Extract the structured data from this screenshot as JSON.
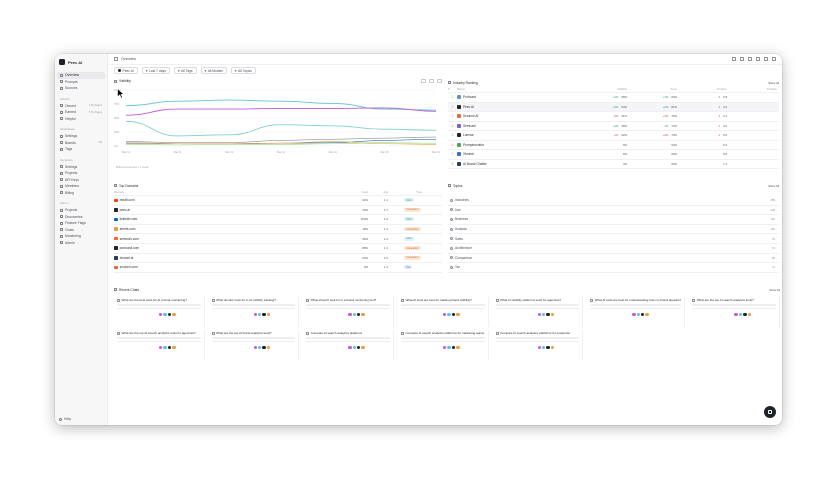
{
  "workspace": {
    "name": "Peec AI"
  },
  "sidebar": {
    "sections": [
      {
        "items": [
          {
            "label": "Overview",
            "icon": "home-icon",
            "active": true
          },
          {
            "label": "Prompts",
            "icon": "message-icon"
          },
          {
            "label": "Sources",
            "icon": "link-icon"
          }
        ]
      },
      {
        "label": "Actions",
        "items": [
          {
            "label": "Owned",
            "tag": "1.3K Pages",
            "icon": "file-icon"
          },
          {
            "label": "Earned",
            "tag": "7.7K Pages",
            "icon": "globe-icon"
          },
          {
            "label": "Helpful",
            "icon": "star-icon"
          }
        ]
      },
      {
        "label": "Workspace",
        "items": [
          {
            "label": "Settings",
            "icon": "gear-icon"
          },
          {
            "label": "Brands",
            "tag": "4/5",
            "icon": "tag-icon"
          },
          {
            "label": "Tags",
            "icon": "hash-icon"
          }
        ]
      },
      {
        "label": "Company",
        "items": [
          {
            "label": "Settings",
            "icon": "gear-icon"
          },
          {
            "label": "Projects",
            "icon": "folder-icon"
          },
          {
            "label": "API Keys",
            "icon": "key-icon"
          },
          {
            "label": "Members",
            "icon": "users-icon"
          },
          {
            "label": "Billing",
            "icon": "card-icon"
          }
        ]
      },
      {
        "label": "Admin",
        "items": [
          {
            "label": "Projects",
            "icon": "folder-icon"
          },
          {
            "label": "Discoveries",
            "icon": "search-icon"
          },
          {
            "label": "Feature Flags",
            "icon": "flag-icon"
          },
          {
            "label": "Chats",
            "icon": "chat-icon"
          },
          {
            "label": "Monitoring",
            "icon": "activity-icon"
          },
          {
            "label": "Admin",
            "icon": "shield-icon"
          }
        ]
      }
    ],
    "footer": "Help"
  },
  "topbar": {
    "title": "Overview"
  },
  "filters": [
    {
      "label": "Peec AI"
    },
    {
      "label": "Last 7 days"
    },
    {
      "label": "All Tags"
    },
    {
      "label": "All Models"
    },
    {
      "label": "All Topics"
    }
  ],
  "visibility": {
    "title": "Visibility",
    "footer": "Brand perception • 1 week"
  },
  "chart_data": {
    "type": "line",
    "x": [
      "Mar 10",
      "Mar 11",
      "Mar 12",
      "Mar 13",
      "Mar 14",
      "Mar 15",
      "Mar 16"
    ],
    "ylim": [
      0,
      100
    ],
    "yticks": [
      "100%",
      "75%",
      "50%",
      "25%",
      "0%"
    ],
    "grid": true,
    "series": [
      {
        "color": "#5fc3d6",
        "values": [
          72,
          80,
          82,
          80,
          76,
          66,
          64
        ]
      },
      {
        "color": "#c05bd6",
        "values": [
          55,
          66,
          66,
          67,
          67,
          68,
          62
        ]
      },
      {
        "color": "#7fd1c9",
        "values": [
          44,
          18,
          20,
          38,
          36,
          30,
          28
        ]
      },
      {
        "color": "#3a6fb0",
        "values": [
          5,
          4,
          4,
          5,
          6,
          10,
          12
        ]
      },
      {
        "color": "#e0a248",
        "values": [
          6,
          4,
          4,
          5,
          8,
          4,
          3
        ]
      },
      {
        "color": "#8a8f97",
        "values": [
          8,
          6,
          6,
          10,
          12,
          14,
          16
        ]
      },
      {
        "color": "#9ad77e",
        "values": [
          3,
          2,
          3,
          3,
          4,
          6,
          5
        ]
      }
    ]
  },
  "competitors": {
    "title": "Industry Ranking",
    "show_all": "Show All",
    "headers": [
      "#",
      "Brand",
      "Visibility",
      "Sent.",
      "Position",
      "Position"
    ],
    "rows": [
      {
        "rank": "1",
        "name": "Profound",
        "color": "#6b8fbf",
        "v": "+2%",
        "v2": "68%",
        "s": "+1%",
        "s2": "84%",
        "p": "2",
        "p2": "2.8",
        "trend": "pos"
      },
      {
        "rank": "2",
        "name": "Peec AI",
        "color": "#1f2328",
        "v": "+3%",
        "v2": "64%",
        "s": "+2%",
        "s2": "81%",
        "p": "2",
        "p2": "3.2",
        "trend": "pos",
        "hl": true
      },
      {
        "rank": "3",
        "name": "Scrunch AI",
        "color": "#e76a3a",
        "v": "-4%",
        "v2": "41%",
        "s": "+1%",
        "s2": "76%",
        "p": "1",
        "p2": "4.1",
        "trend": "neg"
      },
      {
        "rank": "4",
        "name": "Semrush",
        "color": "#7b5bd6",
        "v": "+2%",
        "v2": "38%",
        "s": "-1%",
        "s2": "72%",
        "p": "1",
        "p2": "4.6",
        "trend": "pos"
      },
      {
        "rank": "5",
        "name": "Lumina",
        "color": "#1f2328",
        "v": "-1%",
        "v2": "22%",
        "s": "+2%",
        "s2": "70%",
        "p": "1",
        "p2": "5.0",
        "trend": "neg"
      },
      {
        "rank": "6",
        "name": "Promptmonitor",
        "color": "#5aa05a",
        "v": "",
        "v2": "9%",
        "s": "",
        "s2": "64%",
        "p": "",
        "p2": "6.2",
        "trend": "pos"
      },
      {
        "rank": "7",
        "name": "Xfunnel",
        "color": "#3f6fd6",
        "v": "",
        "v2": "6%",
        "s": "",
        "s2": "60%",
        "p": "",
        "p2": "6.8",
        "trend": "pos"
      },
      {
        "rank": "8",
        "name": "AI Brand Chatter",
        "color": "#2b3a55",
        "v": "",
        "v2": "4%",
        "s": "",
        "s2": "55%",
        "p": "",
        "p2": "7.1",
        "trend": "pos"
      }
    ]
  },
  "sources": {
    "title": "Top Domains",
    "headers": [
      "Domain",
      "Used",
      "Avg.",
      "Type"
    ],
    "rows": [
      {
        "domain": "reddit.com",
        "fav": "#ff4500",
        "usage": "62%",
        "avg": "1.1",
        "type": "UGC",
        "cls": "ugc"
      },
      {
        "domain": "peec.ai",
        "fav": "#1f2328",
        "usage": "29%",
        "avg": "1.7",
        "type": "Competitor",
        "cls": "comp"
      },
      {
        "domain": "linkedin.com",
        "fav": "#0a66c2",
        "usage": "100%",
        "avg": "1.0",
        "type": "UGC",
        "cls": "ugc"
      },
      {
        "domain": "ahrefs.com",
        "fav": "#e0a248",
        "usage": "18%",
        "avg": "1.3",
        "type": "Competitor",
        "cls": "comp"
      },
      {
        "domain": "semrush.com",
        "fav": "#ff642d",
        "usage": "90%",
        "avg": "1.2",
        "type": "UGC",
        "cls": "ugc"
      },
      {
        "domain": "profound.com",
        "fav": "#1f2328",
        "usage": "88%",
        "avg": "1.1",
        "type": "Competitor",
        "cls": "comp"
      },
      {
        "domain": "xfunnel.ai",
        "fav": "#2b3a55",
        "usage": "84%",
        "avg": "1.5",
        "type": "Competitor",
        "cls": "comp"
      },
      {
        "domain": "scrunch.com",
        "fav": "#e76a3a",
        "usage": "9%",
        "avg": "1.2",
        "type": "You",
        "cls": "you"
      }
    ]
  },
  "topics": {
    "title": "Topics",
    "show_all": "Show All",
    "rows": [
      {
        "label": "Industries",
        "n": "289"
      },
      {
        "label": "Use",
        "n": "238"
      },
      {
        "label": "Business",
        "n": "191"
      },
      {
        "label": "Analysis",
        "n": "181"
      },
      {
        "label": "Sales",
        "n": "79"
      },
      {
        "label": "Architecture",
        "n": "74"
      },
      {
        "label": "Comparison",
        "n": "36"
      },
      {
        "label": "Tax",
        "n": "11"
      }
    ]
  },
  "prompts": {
    "title": "Recent Chats",
    "show_all": "Show All",
    "cards": [
      {
        "title": "What are the best tools for AI prompt monitoring?"
      },
      {
        "title": "What should I look for in AI visibility tracking?"
      },
      {
        "title": "What should I look for in a brand monitoring tool?"
      },
      {
        "title": "What AI tools are best for tracking brand visibility?"
      },
      {
        "title": "What AI visibility platforms work for agencies?"
      },
      {
        "title": "What AI tools are best for understanding how my brand appears?"
      },
      {
        "title": "What are the top AI search analytics tools?"
      },
      {
        "title": "What are the top AI search analytics tools for agencies?"
      },
      {
        "title": "What are the top AI brand analytics tools?"
      },
      {
        "title": "Compare AI search analytics platforms"
      },
      {
        "title": "Compare AI search analytics platforms for marketing teams"
      },
      {
        "title": "Compare AI search analytics platforms for enterprise"
      }
    ]
  }
}
